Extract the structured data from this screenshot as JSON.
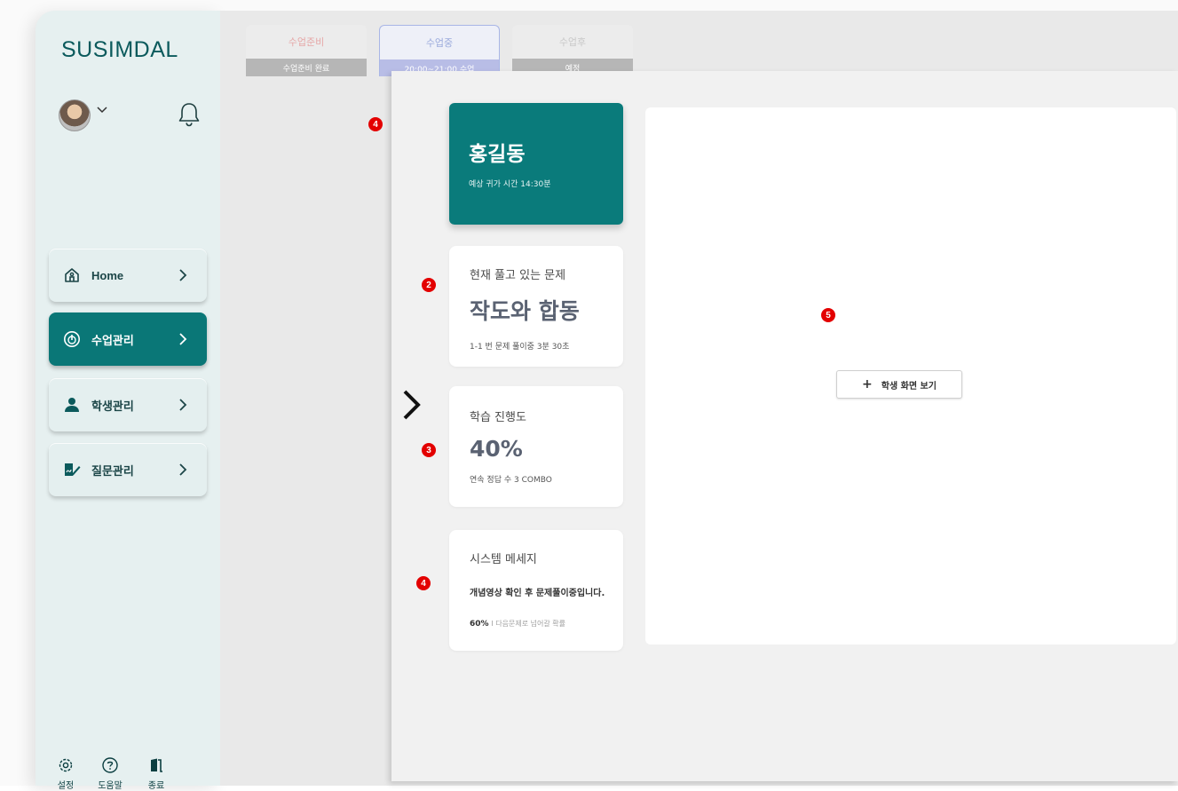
{
  "app": {
    "brand": "SUSIMDAL"
  },
  "sidebar": {
    "items": [
      {
        "label": "Home",
        "icon": "home-icon"
      },
      {
        "label": "수업관리",
        "icon": "class-icon",
        "active": true
      },
      {
        "label": "학생관리",
        "icon": "person-icon"
      },
      {
        "label": "질문관리",
        "icon": "question-edit-icon"
      }
    ],
    "footer": [
      {
        "label": "설정",
        "icon": "gear-icon"
      },
      {
        "label": "도움말",
        "icon": "help-icon"
      },
      {
        "label": "종료",
        "icon": "exit-door-icon"
      }
    ]
  },
  "tabs": [
    {
      "title": "수업준비",
      "sub": "수업준비 완료"
    },
    {
      "title": "수업중",
      "sub": "20:00~21:00 수업"
    },
    {
      "title": "수업후",
      "sub": "예정"
    }
  ],
  "student": {
    "name": "홍길동",
    "return_time": "예상 귀가 시간 14:30분"
  },
  "current_problem": {
    "title": "현재 풀고 있는 문제",
    "name": "작도와 합동",
    "meta": "1-1 번 문제 풀이중   3분 30초"
  },
  "progress": {
    "title": "학습 진행도",
    "percent": "40%",
    "meta": "연속 정답 수  3 COMBO"
  },
  "system": {
    "title": "시스템 메세지",
    "message": "개념영상 확인 후 문제풀이중입니다.",
    "rate": "60%",
    "rate_label": "I 다음문제로 넘어갈  확률"
  },
  "viewer": {
    "button_label": "학생 화면 보기"
  },
  "markers": [
    "4",
    "2",
    "3",
    "4",
    "5"
  ],
  "colors": {
    "accent": "#0a7b7b",
    "marker": "#e30000"
  }
}
